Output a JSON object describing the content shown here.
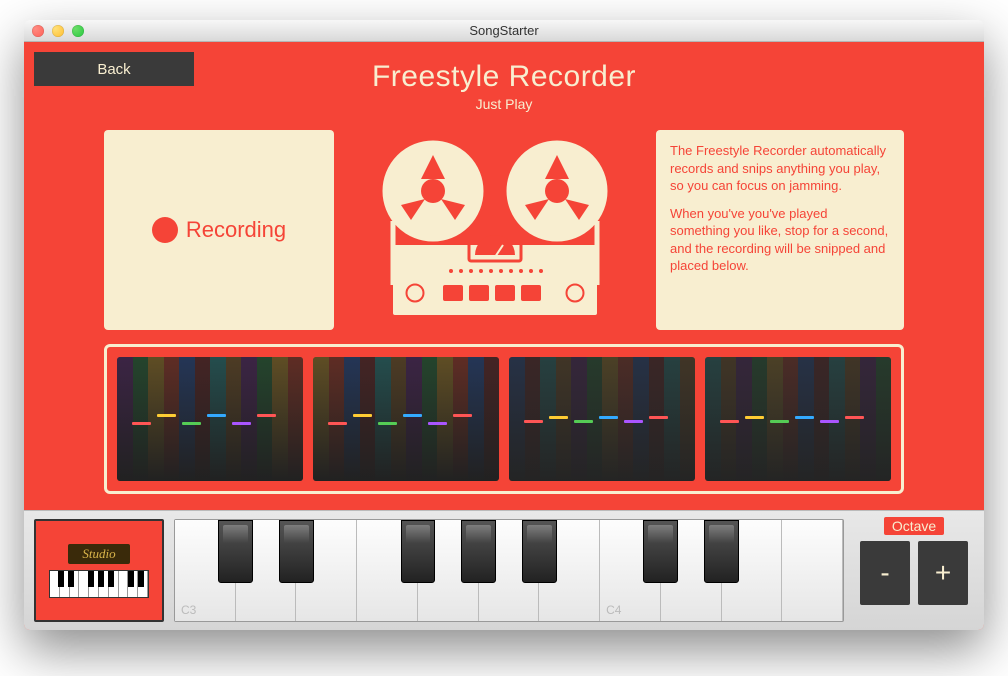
{
  "window": {
    "title": "SongStarter"
  },
  "header": {
    "back_label": "Back",
    "title": "Freestyle Recorder",
    "subtitle": "Just Play"
  },
  "record": {
    "status": "Recording"
  },
  "info": {
    "p1": "The Freestyle Recorder automatically records and snips anything you play, so you can focus on jamming.",
    "p2": "When you've you've played something you like, stop for a second, and the recording will be snipped and placed below."
  },
  "clips": [
    {
      "id": 1
    },
    {
      "id": 2
    },
    {
      "id": 3
    },
    {
      "id": 4
    }
  ],
  "studio": {
    "label": "Studio"
  },
  "piano": {
    "white_keys": [
      "C3",
      "D3",
      "E3",
      "F3",
      "G3",
      "A3",
      "B3",
      "C4",
      "D4",
      "E4",
      "F4"
    ],
    "labeled": {
      "0": "C3",
      "7": "C4"
    },
    "black_positions": [
      0,
      1,
      3,
      4,
      5,
      7,
      8
    ]
  },
  "octave": {
    "label": "Octave",
    "minus": "-",
    "plus": "+"
  },
  "colors": {
    "accent": "#F54437",
    "cream": "#F8EED0",
    "dark": "#3a3a3a"
  }
}
